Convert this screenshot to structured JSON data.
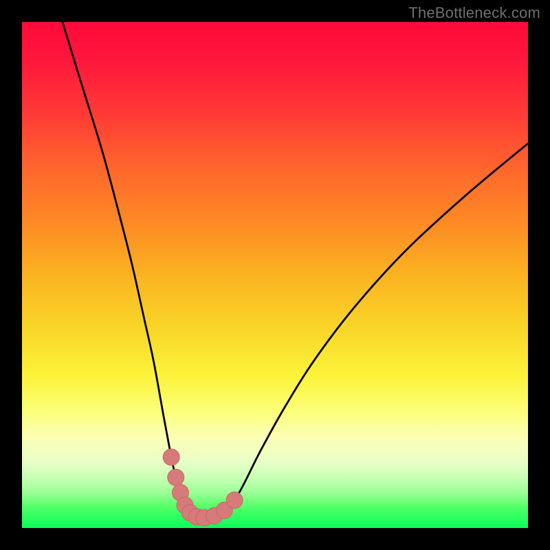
{
  "watermark": "TheBottleneck.com",
  "colors": {
    "frame": "#000000",
    "curve_stroke": "#000000",
    "marker_fill": "#d67a7a",
    "marker_stroke": "#c86868"
  },
  "chart_data": {
    "type": "line",
    "title": "",
    "xlabel": "",
    "ylabel": "",
    "xlim": [
      0,
      100
    ],
    "ylim": [
      0,
      100
    ],
    "grid": false,
    "legend": false,
    "series": [
      {
        "name": "left-curve",
        "x": [
          8,
          12,
          16,
          20,
          22,
          24,
          26,
          28,
          29.5,
          30.4,
          31.3,
          32.2,
          33.2,
          34.5,
          36
        ],
        "values": [
          100,
          87,
          74,
          59,
          51,
          42,
          33,
          22,
          14,
          10,
          7,
          4.5,
          3,
          2.2,
          2
        ]
      },
      {
        "name": "right-curve",
        "x": [
          36,
          38,
          40,
          42,
          44,
          47,
          52,
          58,
          66,
          76,
          88,
          100
        ],
        "values": [
          2,
          2.4,
          3.5,
          5.5,
          9,
          15,
          24,
          33.5,
          44,
          55,
          66,
          76
        ]
      }
    ],
    "markers": {
      "name": "highlight-points",
      "x": [
        29.5,
        30.4,
        31.3,
        32.2,
        33.2,
        34.5,
        36,
        38,
        40,
        42
      ],
      "values": [
        14,
        10,
        7,
        4.5,
        3,
        2.2,
        2,
        2.4,
        3.5,
        5.5
      ],
      "radius": 12
    }
  }
}
